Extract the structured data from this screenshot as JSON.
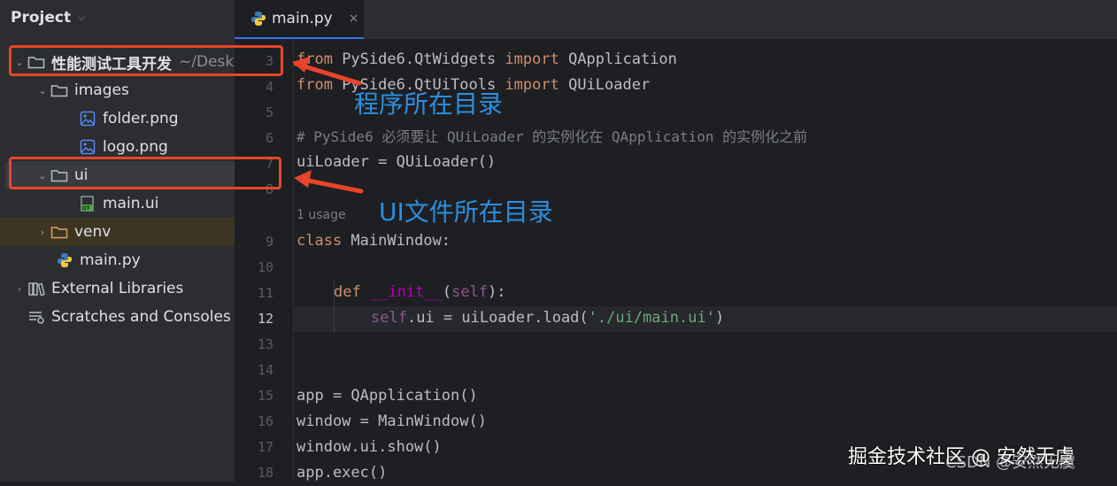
{
  "sidebar": {
    "title": "Project",
    "items": [
      {
        "label": "性能测试工具开发",
        "sub": "~/Desk",
        "depth": 0,
        "expanded": true,
        "icon": "folder-icon"
      },
      {
        "label": "images",
        "depth": 1,
        "expanded": true,
        "icon": "folder-icon"
      },
      {
        "label": "folder.png",
        "depth": 2,
        "icon": "image-file-icon"
      },
      {
        "label": "logo.png",
        "depth": 2,
        "icon": "image-file-icon"
      },
      {
        "label": "ui",
        "depth": 1,
        "expanded": true,
        "icon": "folder-icon"
      },
      {
        "label": "main.ui",
        "depth": 2,
        "icon": "qt-ui-file-icon"
      },
      {
        "label": "venv",
        "depth": 1,
        "expanded": false,
        "icon": "folder-icon"
      },
      {
        "label": "main.py",
        "depth": 1,
        "icon": "python-file-icon"
      },
      {
        "label": "External Libraries",
        "depth": 0,
        "expanded": false,
        "icon": "library-icon"
      },
      {
        "label": "Scratches and Consoles",
        "depth": 0,
        "icon": "scratches-icon"
      }
    ]
  },
  "editor": {
    "tab": {
      "label": "main.py",
      "close": "×"
    },
    "active_line": "12",
    "usage_hint": "1 usage",
    "line_numbers": [
      "3",
      "4",
      "5",
      "6",
      "7",
      "8",
      "9",
      "10",
      "11",
      "12",
      "13",
      "14",
      "15",
      "16",
      "17",
      "18"
    ],
    "code": {
      "l3": {
        "kw1": "from",
        "mod": " PySide6.QtWidgets ",
        "kw2": "import",
        "name": " QApplication"
      },
      "l4": {
        "kw1": "from",
        "mod": " PySide6.QtUiTools ",
        "kw2": "import",
        "name": " QUiLoader"
      },
      "l6": "# PySide6 必须要让 QUiLoader 的实例化在 QApplication 的实例化之前",
      "l7": "uiLoader = QUiLoader()",
      "l9": {
        "kw": "class",
        "name": " MainWindow:"
      },
      "l11": {
        "kw": "def",
        "magic": "__init__",
        "open": "(",
        "self": "self",
        "close": "):"
      },
      "l12": {
        "self": "self",
        "mid": ".ui = uiLoader.load(",
        "str": "'./ui/main.ui'",
        "end": ")"
      },
      "l15": "app = QApplication()",
      "l16": "window = MainWindow()",
      "l17": "window.ui.show()",
      "l18": "app.exec()"
    }
  },
  "annotations": {
    "program_dir": "程序所在目录",
    "ui_dir": "UI文件所在目录"
  },
  "watermark": {
    "primary": "掘金技术社区 @ 安然无虞",
    "secondary": "CSDN @安然无虞"
  },
  "colors": {
    "annotation_red": "#e8452a",
    "annotation_blue": "#2a8fe0",
    "keyword": "#cf8e6d",
    "string": "#6aab73",
    "comment": "#7a7e85"
  }
}
